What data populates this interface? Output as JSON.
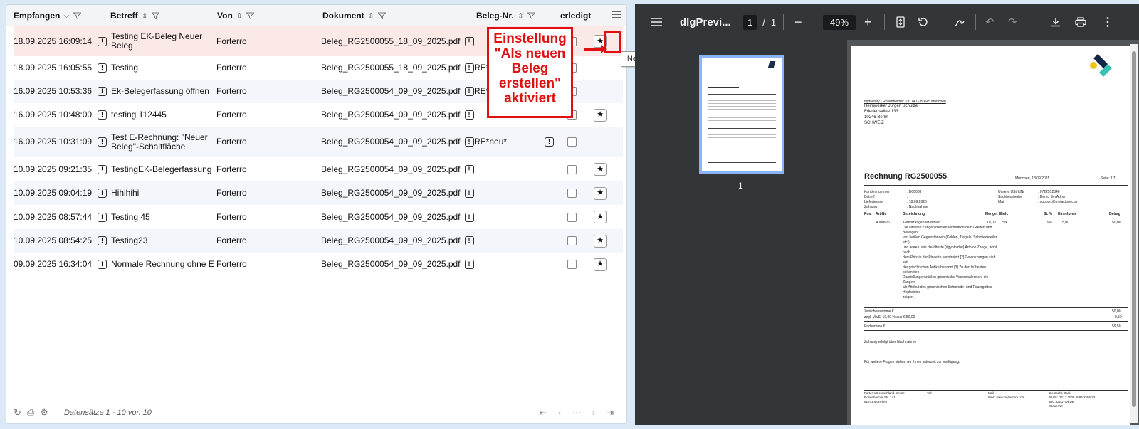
{
  "grid": {
    "columns": [
      {
        "label": "Empfangen"
      },
      {
        "label": "Betreff"
      },
      {
        "label": "Von"
      },
      {
        "label": "Dokument"
      },
      {
        "label": "Beleg-Nr."
      },
      {
        "label": "erledigt"
      }
    ],
    "rows": [
      {
        "date": "18.09.2025 16:09:14",
        "subject": "Testing EK-Beleg Neuer Beleg",
        "from": "Forterro",
        "doc": "Beleg_RG2500055_18_09_2025.pdf",
        "beleg": ""
      },
      {
        "date": "18.09.2025 16:05:55",
        "subject": "Testing",
        "from": "Forterro",
        "doc": "Beleg_RG2500055_18_09_2025.pdf",
        "beleg": "RE*neu*"
      },
      {
        "date": "16.09.2025 10:53:36",
        "subject": "Ek-Belegerfassung öffnen",
        "from": "Forterro",
        "doc": "Beleg_RG2500054_09_09_2025.pdf",
        "beleg": "RE*neu*"
      },
      {
        "date": "16.09.2025 10:48:00",
        "subject": "testing 112445",
        "from": "Forterro",
        "doc": "Beleg_RG2500054_09_09_2025.pdf",
        "beleg": ""
      },
      {
        "date": "16.09.2025 10:31:09",
        "subject": "Test E-Rechnung: \"Neuer Beleg\"-Schaltfläche",
        "from": "Forterro",
        "doc": "Beleg_RG2500054_09_09_2025.pdf",
        "beleg": "RE*neu*"
      },
      {
        "date": "10.09.2025 09:21:35",
        "subject": "TestingEK-Belegerfassung",
        "from": "Forterro",
        "doc": "Beleg_RG2500054_09_09_2025.pdf",
        "beleg": ""
      },
      {
        "date": "10.09.2025 09:04:19",
        "subject": "Hihihihi",
        "from": "Forterro",
        "doc": "Beleg_RG2500054_09_09_2025.pdf",
        "beleg": ""
      },
      {
        "date": "10.09.2025 08:57:44",
        "subject": "Testing 45",
        "from": "Forterro",
        "doc": "Beleg_RG2500054_09_09_2025.pdf",
        "beleg": ""
      },
      {
        "date": "10.09.2025 08:54:25",
        "subject": "Testing23",
        "from": "Forterro",
        "doc": "Beleg_RG2500054_09_09_2025.pdf",
        "beleg": ""
      },
      {
        "date": "09.09.2025 16:34:04",
        "subject": "Normale Rechnung ohne E",
        "from": "Forterro",
        "doc": "Beleg_RG2500054_09_09_2025.pdf",
        "beleg": ""
      }
    ],
    "footer": {
      "records": "Datensätze 1 - 10 von 10"
    },
    "star_glyph": "★",
    "info_glyph": "!"
  },
  "annotation": {
    "text": "Einstellung \"Als neuen Beleg erstellen\" aktiviert",
    "tooltip": "Neu",
    "color": "#e01010"
  },
  "pdf": {
    "title": "dlgPrevi...",
    "page_current": "1",
    "page_sep": "/",
    "page_total": "1",
    "zoom": "49%",
    "thumb_label": "1",
    "doc": {
      "sender_line": "myfactory - Rosenheimer Str. 141 - 80645 München",
      "recipient": [
        "Heimwerker Jürgen Schulze",
        "Friedensallee 133",
        "10246     Berlin",
        "SCHWEIZ"
      ],
      "heading": "Rechnung RG2500055",
      "place_date": "München, 18.09.2025",
      "page_info": "Seite: 1/1",
      "meta_left": [
        [
          "Kundennummer",
          ": D00008"
        ],
        [
          "Betreff",
          ":"
        ],
        [
          "Liefertermin",
          ": 18.09.2025"
        ],
        [
          "Zahlung",
          ": Nachnahme"
        ]
      ],
      "meta_right": [
        [
          "Unsere USt-IdNr",
          ": 0722512346"
        ],
        [
          "Sachbearbeiter",
          ": Demo SysAdmin"
        ],
        [
          "Mail",
          ": support@myfactory.com"
        ]
      ],
      "table_head": [
        "Pos.",
        "Art-Nr.",
        "Bezeichnung",
        "Menge",
        "Einh.",
        "St. %",
        "Einzelpreis",
        "Betrag"
      ],
      "item": {
        "pos": "1",
        "art": "A000026",
        "menge": "10,00",
        "einh": "Stk",
        "st": "19%",
        "preis": "5,00",
        "betrag": "50,00"
      },
      "description": [
        "Kombizangenset-isoliert",
        "Die ältesten Zangen dienten vermutlich dem Greifen und",
        "Bewegen",
        "von heißen Gegenständen (Kohlen, Tiegeln, Schmiedeteilen",
        "etc.)",
        "und waren, wie die älteste (ägyptische) Art von Zange, wohl",
        "nach",
        "dem Prinzip der Pinzette konstruiert.[2] Gelenkzangen sind",
        "seit",
        "der griechischen Antike bekannt.[3] Zu den frühesten",
        "bekannten",
        "Darstellungen zählen griechische Vasenmalereien, die",
        "Zangen",
        "als Attribut des griechischen Schmiede- und Feuergottes",
        "Hephaistos",
        "zeigen."
      ],
      "zwischensumme_label": "Zwischensumme €",
      "zwischensumme": "50,00",
      "mwst_label": "zzgl. MwSt 19,00 % aus € 50,00",
      "mwst": "9,50",
      "endsumme_label": "Endsumme €",
      "endsumme": "59,50",
      "payment_note": "Zahlung erfolgt über Nachnahme",
      "closing": "Für weitere Fragen stehen wir Ihnen jederzeit zur Verfügung.",
      "footer_cols": [
        [
          "Forterro Deutschland GmbH",
          "Rosenheimer Str. 141",
          "81671 München"
        ],
        [
          "Tel:"
        ],
        [
          "Mail:",
          "Web: www.myfactory.com"
        ],
        [
          "Deutsche Bank",
          "IBAN: DE17 2005 2584 2586 23",
          "BIC: DEUTDEDB",
          "SteuerNr:"
        ]
      ]
    }
  }
}
